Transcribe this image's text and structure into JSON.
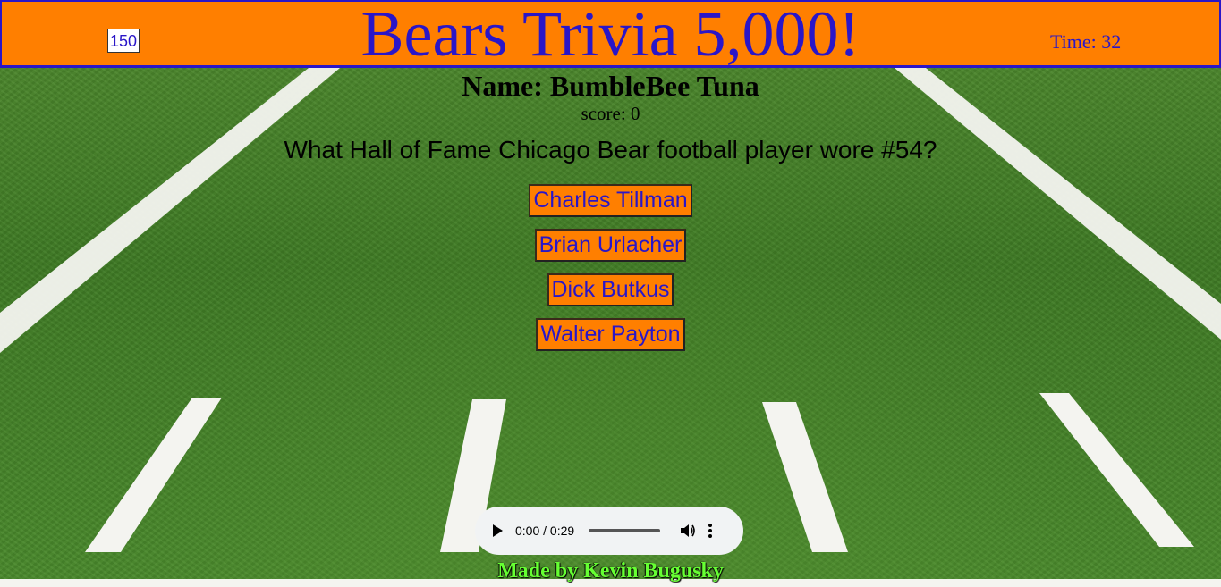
{
  "header": {
    "points": "150",
    "title": "Bears Trivia 5,000!",
    "timer": "Time: 32"
  },
  "player": {
    "name": "Name: BumbleBee Tuna",
    "score": "score: 0"
  },
  "question": {
    "text": "What Hall of Fame Chicago Bear football player wore #54?",
    "answers": [
      "Charles Tillman",
      "Brian Urlacher",
      "Dick Butkus",
      "Walter Payton"
    ]
  },
  "audio": {
    "time": "0:00 / 0:29",
    "icons": [
      "play-icon",
      "volume-icon",
      "more-options-icon"
    ]
  },
  "footer": {
    "credit": "Made by Kevin Bugusky"
  },
  "colors": {
    "header_bg": "#ff7f00",
    "header_text": "#2a16c8",
    "footer_text": "#66ff33"
  }
}
